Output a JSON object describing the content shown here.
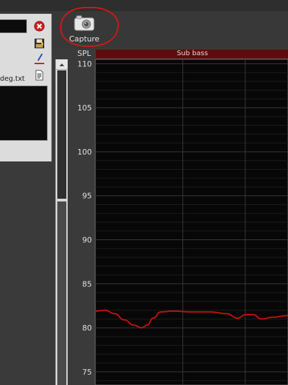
{
  "toolbar": {
    "capture_label": "Capture",
    "capture_icon": "camera-icon",
    "highlight_color": "#d01818"
  },
  "panel": {
    "filename": "deg.txt",
    "icons": [
      "close-icon",
      "save-icon",
      "pen-icon",
      "document-icon"
    ]
  },
  "chart": {
    "band_label": "Sub bass",
    "band_color": "#5a0d0d",
    "line_color": "#c01010"
  },
  "chart_data": {
    "type": "line",
    "ylabel": "SPL",
    "ylim": [
      73.5,
      110.5
    ],
    "y_ticks": [
      "110",
      "105",
      "100",
      "95",
      "90",
      "85",
      "80",
      "75"
    ],
    "x_range": [
      0,
      1
    ],
    "x_gridlines": [
      0.454,
      0.778
    ],
    "series": [
      {
        "values": [
          [
            0.0,
            81.9
          ],
          [
            0.05,
            82.0
          ],
          [
            0.1,
            81.6
          ],
          [
            0.15,
            80.9
          ],
          [
            0.2,
            80.3
          ],
          [
            0.24,
            80.0
          ],
          [
            0.27,
            80.3
          ],
          [
            0.3,
            81.1
          ],
          [
            0.34,
            81.8
          ],
          [
            0.4,
            81.9
          ],
          [
            0.5,
            81.8
          ],
          [
            0.6,
            81.8
          ],
          [
            0.68,
            81.6
          ],
          [
            0.74,
            81.1
          ],
          [
            0.78,
            81.5
          ],
          [
            0.82,
            81.5
          ],
          [
            0.86,
            81.0
          ],
          [
            0.92,
            81.2
          ],
          [
            1.0,
            81.4
          ]
        ]
      }
    ]
  }
}
